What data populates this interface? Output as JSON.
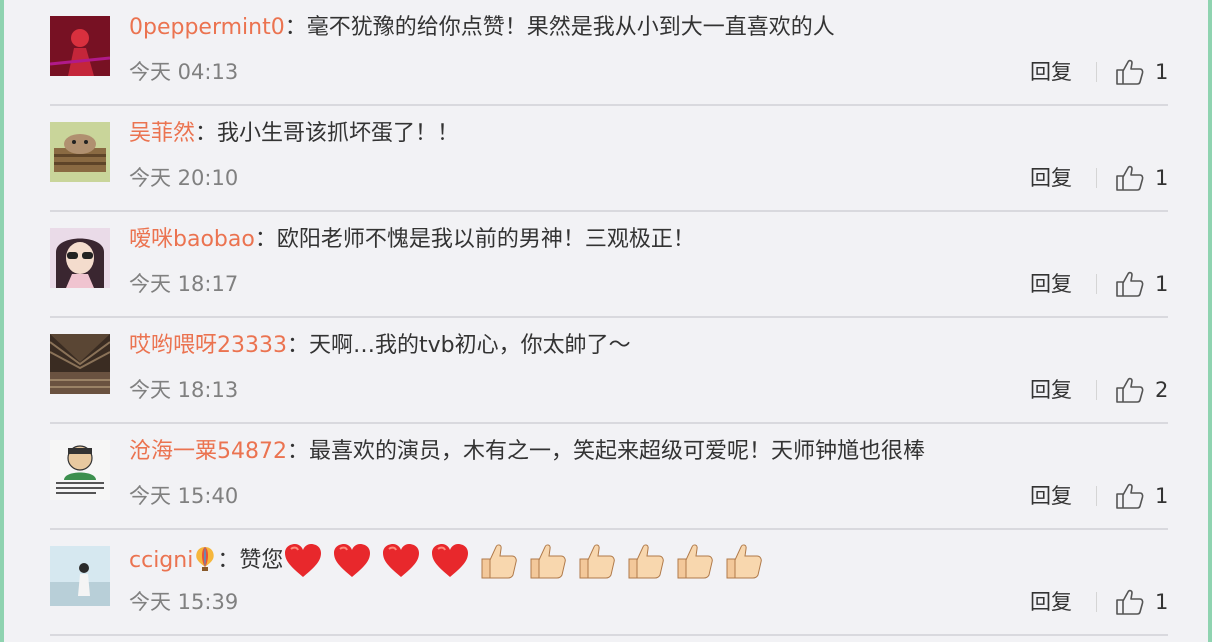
{
  "comments": [
    {
      "user": "0peppermint0",
      "text": "毫不犹豫的给你点赞！果然是我从小到大一直喜欢的人",
      "time": "今天 04:13",
      "reply_label": "回复",
      "likes": "1",
      "avatar_colors": [
        "#6b1220",
        "#c4263a",
        "#2a0a2a"
      ]
    },
    {
      "user": "吴菲然",
      "text": "我小生哥该抓坏蛋了！！",
      "time": "今天 20:10",
      "reply_label": "回复",
      "likes": "1",
      "avatar_colors": [
        "#b8a07a",
        "#7a5a3a",
        "#d9cba8"
      ]
    },
    {
      "user": "嗳咪baobao",
      "text": "欧阳老师不愧是我以前的男神！三观极正！",
      "time": "今天 18:17",
      "reply_label": "回复",
      "likes": "1",
      "avatar_colors": [
        "#d7c0d5",
        "#3a2a3a",
        "#f0e3ee"
      ]
    },
    {
      "user": "哎哟喂呀23333",
      "text": "天啊…我的tvb初心，你太帥了～",
      "time": "今天 18:13",
      "reply_label": "回复",
      "likes": "2",
      "avatar_colors": [
        "#4a3a2e",
        "#8a7258",
        "#2a2018"
      ]
    },
    {
      "user": "沧海一粟54872",
      "text": "最喜欢的演员，木有之一，笑起来超级可爱呢！天师钟馗也很棒",
      "time": "今天 15:40",
      "reply_label": "回复",
      "likes": "1",
      "avatar_colors": [
        "#f4f4f4",
        "#3c8f4e",
        "#222222"
      ]
    },
    {
      "user": "ccigni",
      "text": "赞您",
      "time": "今天 15:39",
      "reply_label": "回复",
      "likes": "1",
      "avatar_colors": [
        "#cfe6f0",
        "#9ab7c4",
        "#f2f6f8"
      ],
      "badge_icon": "balloon-icon",
      "emojis": [
        "heart-icon",
        "heart-icon",
        "heart-icon",
        "heart-icon",
        "thumbs-up-emoji",
        "thumbs-up-emoji",
        "thumbs-up-emoji",
        "thumbs-up-emoji",
        "thumbs-up-emoji",
        "thumbs-up-emoji"
      ]
    }
  ],
  "colors": {
    "username": "#eb7350",
    "text": "#333333",
    "meta": "#808080",
    "background": "#f2f2f5",
    "outer": "#8fd3b0"
  }
}
